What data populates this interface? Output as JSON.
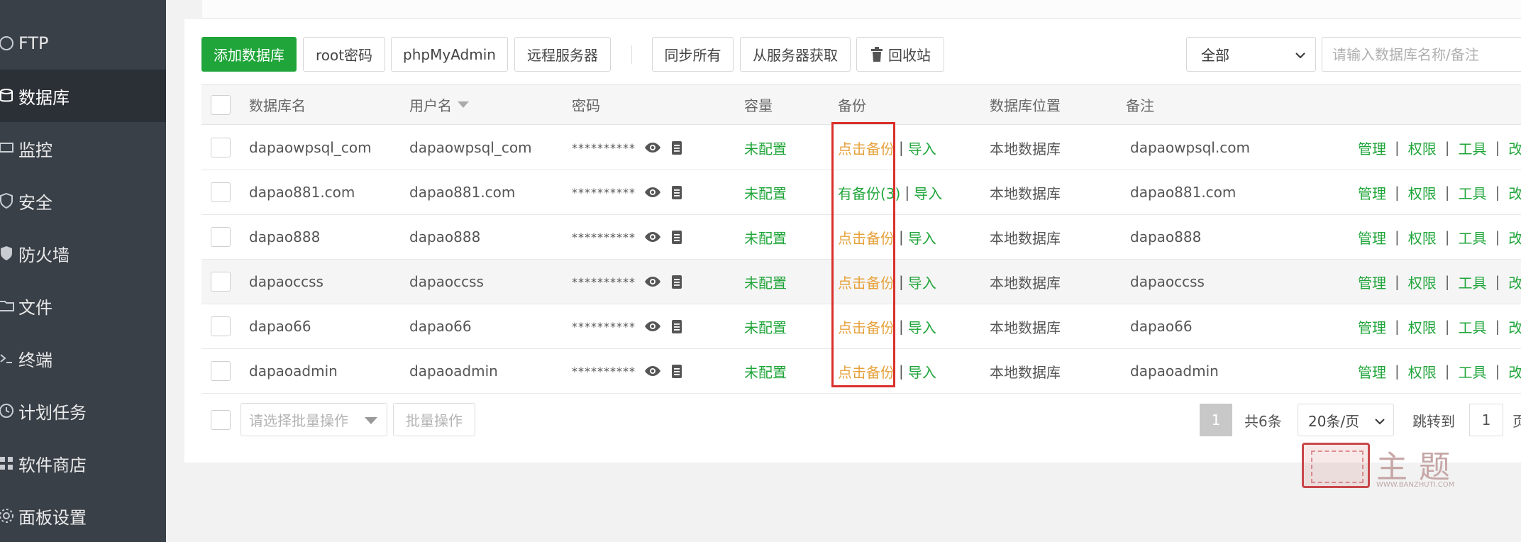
{
  "sidebar": {
    "items": [
      {
        "label": "FTP",
        "icon": "ftp-icon",
        "active": false
      },
      {
        "label": "数据库",
        "icon": "database-icon",
        "active": true
      },
      {
        "label": "监控",
        "icon": "monitor-icon",
        "active": false
      },
      {
        "label": "安全",
        "icon": "shield-icon",
        "active": false
      },
      {
        "label": "防火墙",
        "icon": "firewall-icon",
        "active": false
      },
      {
        "label": "文件",
        "icon": "folder-icon",
        "active": false
      },
      {
        "label": "终端",
        "icon": "terminal-icon",
        "active": false
      },
      {
        "label": "计划任务",
        "icon": "clock-icon",
        "active": false
      },
      {
        "label": "软件商店",
        "icon": "store-icon",
        "active": false
      },
      {
        "label": "面板设置",
        "icon": "gear-icon",
        "active": false
      }
    ]
  },
  "toolbar": {
    "add_db": "添加数据库",
    "root_pwd": "root密码",
    "phpmyadmin": "phpMyAdmin",
    "remote": "远程服务器",
    "sync_all": "同步所有",
    "fetch": "从服务器获取",
    "recycle": "回收站",
    "filter_value": "全部",
    "search_placeholder": "请输入数据库名称/备注"
  },
  "table": {
    "headers": {
      "name": "数据库名",
      "user": "用户名",
      "password": "密码",
      "capacity": "容量",
      "backup": "备份",
      "location": "数据库位置",
      "note": "备注"
    },
    "rows": [
      {
        "name": "dapaowpsql_com",
        "user": "dapaowpsql_com",
        "password": "**********",
        "capacity": "未配置",
        "backup": "点击备份",
        "backup_state": "none",
        "import": "导入",
        "location": "本地数据库",
        "note": "dapaowpsql.com"
      },
      {
        "name": "dapao881.com",
        "user": "dapao881.com",
        "password": "**********",
        "capacity": "未配置",
        "backup": "有备份(3)",
        "backup_state": "has",
        "import": "导入",
        "location": "本地数据库",
        "note": "dapao881.com"
      },
      {
        "name": "dapao888",
        "user": "dapao888",
        "password": "**********",
        "capacity": "未配置",
        "backup": "点击备份",
        "backup_state": "none",
        "import": "导入",
        "location": "本地数据库",
        "note": "dapao888"
      },
      {
        "name": "dapaoccss",
        "user": "dapaoccss",
        "password": "**********",
        "capacity": "未配置",
        "backup": "点击备份",
        "backup_state": "none",
        "import": "导入",
        "location": "本地数据库",
        "note": "dapaoccss"
      },
      {
        "name": "dapao66",
        "user": "dapao66",
        "password": "**********",
        "capacity": "未配置",
        "backup": "点击备份",
        "backup_state": "none",
        "import": "导入",
        "location": "本地数据库",
        "note": "dapao66"
      },
      {
        "name": "dapaoadmin",
        "user": "dapaoadmin",
        "password": "**********",
        "capacity": "未配置",
        "backup": "点击备份",
        "backup_state": "none",
        "import": "导入",
        "location": "本地数据库",
        "note": "dapaoadmin"
      }
    ],
    "ops": {
      "manage": "管理",
      "perm": "权限",
      "tools": "工具",
      "modify": "改密"
    }
  },
  "footer": {
    "batch_placeholder": "请选择批量操作",
    "batch_button": "批量操作",
    "current_page": "1",
    "total": "共6条",
    "page_size": "20条/页",
    "jump_label": "跳转到",
    "jump_value": "1",
    "page_unit": "页"
  },
  "watermark": {
    "text": "主题",
    "sub": "WWW.BANZHUTI.COM"
  },
  "colors": {
    "sidebar_bg": "#3a4048",
    "sidebar_active": "#2b2f36",
    "accent_green": "#20a53a",
    "backup_orange": "#e6a23c",
    "highlight_red": "#d9302b"
  }
}
